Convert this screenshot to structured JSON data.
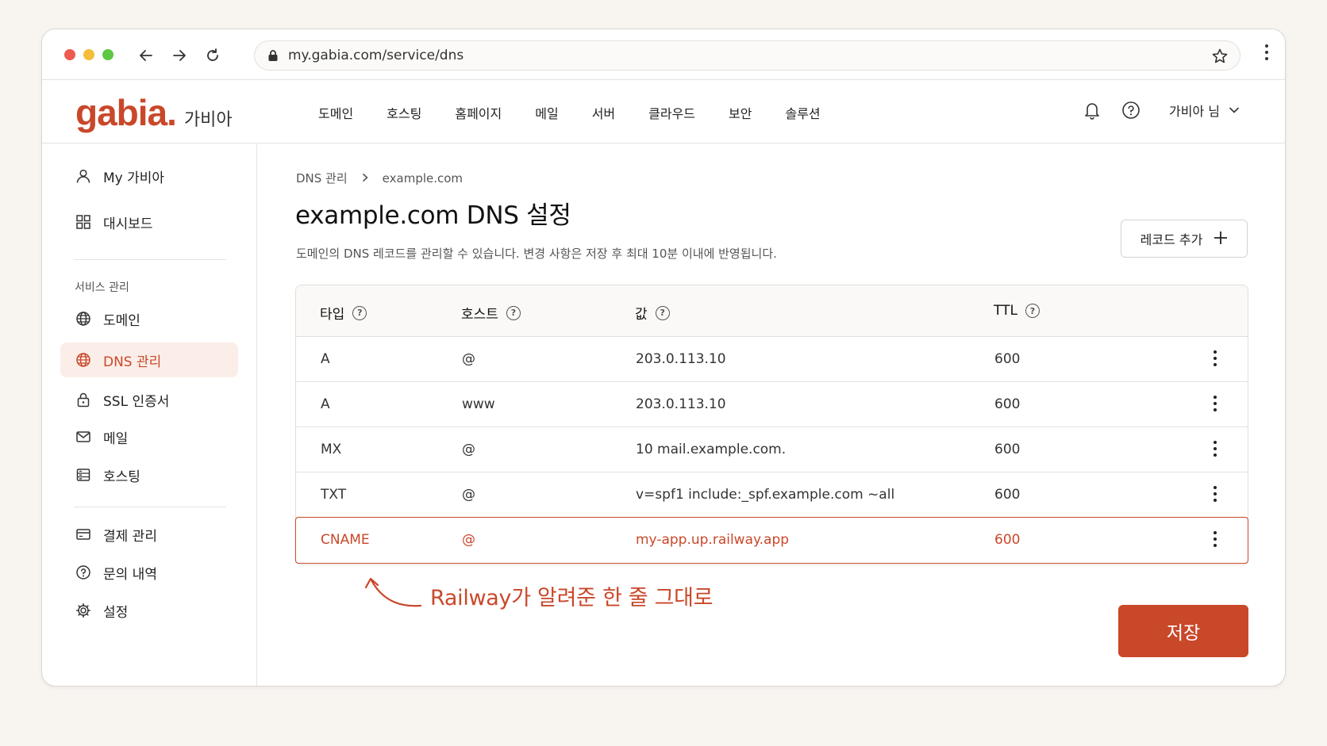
{
  "browser": {
    "url": "my.gabia.com/service/dns"
  },
  "header": {
    "logo": "gabia.",
    "logo_sub": "가비아",
    "nav": [
      "도메인",
      "호스팅",
      "홈페이지",
      "메일",
      "서버",
      "클라우드",
      "보안",
      "솔루션"
    ],
    "user": "가비아 님"
  },
  "sidebar": {
    "items": [
      {
        "label": "My 가비아",
        "icon": "user-icon"
      },
      {
        "label": "대시보드",
        "icon": "dashboard-icon"
      },
      {
        "label": "도메인",
        "icon": "globe-icon"
      },
      {
        "label": "DNS 관리",
        "icon": "globe-icon",
        "active": true
      },
      {
        "label": "SSL 인증서",
        "icon": "lock-icon"
      },
      {
        "label": "메일",
        "icon": "mail-icon"
      },
      {
        "label": "호스팅",
        "icon": "server-icon"
      },
      {
        "label": "결제 관리",
        "icon": "card-icon"
      },
      {
        "label": "문의 내역",
        "icon": "help-icon"
      },
      {
        "label": "설정",
        "icon": "gear-icon"
      }
    ],
    "section_label": "서비스 관리"
  },
  "main": {
    "breadcrumb": [
      "DNS 관리",
      "example.com"
    ],
    "title": "example.com DNS 설정",
    "description": "도메인의 DNS 레코드를 관리할 수 있습니다. 변경 사항은 저장 후 최대 10분 이내에 반영됩니다.",
    "add_record_label": "레코드 추가",
    "save_label": "저장",
    "annotation": "Railway가 알려준 한 줄 그대로"
  },
  "table": {
    "headers": [
      "타입",
      "호스트",
      "값",
      "TTL"
    ],
    "rows": [
      {
        "type": "A",
        "host": "@",
        "value": "203.0.113.10",
        "ttl": "600"
      },
      {
        "type": "A",
        "host": "www",
        "value": "203.0.113.10",
        "ttl": "600"
      },
      {
        "type": "MX",
        "host": "@",
        "value": "10 mail.example.com.",
        "ttl": "600"
      },
      {
        "type": "TXT",
        "host": "@",
        "value": "v=spf1 include:_spf.example.com ~all",
        "ttl": "600"
      },
      {
        "type": "CNAME",
        "host": "@",
        "value": "my-app.up.railway.app",
        "ttl": "600",
        "highlighted": true
      }
    ]
  },
  "colors": {
    "accent": "#c9482a",
    "active_bg": "#fbeee8"
  }
}
